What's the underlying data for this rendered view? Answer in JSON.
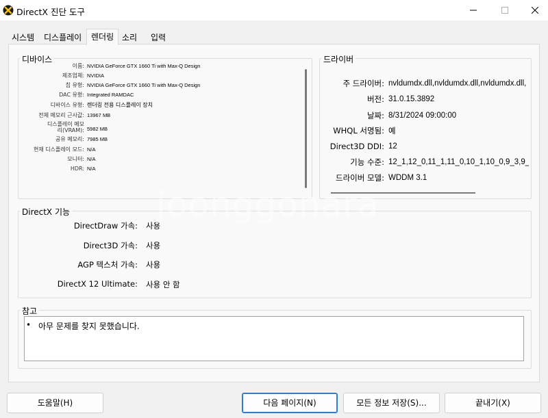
{
  "window": {
    "title": "DirectX 진단 도구",
    "icon": "directx-x-icon"
  },
  "tabs": [
    {
      "label": "시스템",
      "active": false
    },
    {
      "label": "디스플레이",
      "active": false
    },
    {
      "label": "렌더링",
      "active": true
    },
    {
      "label": "소리",
      "active": false
    },
    {
      "label": "입력",
      "active": false
    }
  ],
  "device": {
    "title": "디바이스",
    "rows": [
      {
        "label": "이름:",
        "value": "NVIDIA GeForce GTX 1660 Ti with Max-Q Design"
      },
      {
        "label": "제조업체:",
        "value": "NVIDIA"
      },
      {
        "label": "칩 유형:",
        "value": "NVIDIA GeForce GTX 1660 Ti with Max-Q Design"
      },
      {
        "label": "DAC 유형:",
        "value": "Integrated RAMDAC"
      },
      {
        "label": "디바이스 유형:",
        "value": "렌더링 전용 디스플레이 장치"
      },
      {
        "label": "전체 메모리 근사값:",
        "value": "13967 MB"
      },
      {
        "label": "디스플레이 메모리(VRAM):",
        "value": "5982 MB"
      },
      {
        "label": "공유 메모리:",
        "value": "7985 MB"
      },
      {
        "label": "현재 디스플레이 모드:",
        "value": "N/A"
      },
      {
        "label": "모니터:",
        "value": "N/A"
      },
      {
        "label": "HDR:",
        "value": "N/A"
      }
    ]
  },
  "drivers": {
    "title": "드라이버",
    "rows": [
      {
        "label": "주 드라이버:",
        "value": "nvldumdx.dll,nvldumdx.dll,nvldumdx.dll,"
      },
      {
        "label": "버전:",
        "value": "31.0.15.3892"
      },
      {
        "label": "날짜:",
        "value": "8/31/2024 09:00:00"
      },
      {
        "label": "WHQL 서명됨:",
        "value": "예"
      },
      {
        "label": "Direct3D DDI:",
        "value": "12"
      },
      {
        "label": "기능 수준:",
        "value": "12_1,12_0,11_1,11_0,10_1,10_0,9_3,9_2,9_"
      },
      {
        "label": "드라이버 모델:",
        "value": "WDDM 3.1"
      }
    ]
  },
  "features": {
    "title": "DirectX 기능",
    "rows": [
      {
        "label": "DirectDraw 가속:",
        "value": "사용"
      },
      {
        "label": "Direct3D 가속:",
        "value": "사용"
      },
      {
        "label": "AGP 텍스처 가속:",
        "value": "사용"
      },
      {
        "label": "DirectX 12 Ultimate:",
        "value": "사용 안 함"
      }
    ]
  },
  "notes": {
    "title": "참고",
    "items": [
      "아무 문제를 찾지 못했습니다."
    ]
  },
  "buttons": {
    "help": "도움말(H)",
    "next_page": "다음 페이지(N)",
    "save_all": "모든 정보 저장(S)...",
    "exit": "끝내기(X)"
  },
  "watermark": "joonggonara"
}
